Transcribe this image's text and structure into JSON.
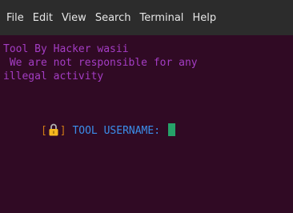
{
  "menubar": {
    "items": [
      "File",
      "Edit",
      "View",
      "Search",
      "Terminal",
      "Help"
    ]
  },
  "terminal": {
    "line1": "Tool By Hacker wasii",
    "line2": " We are not responsible for any",
    "line3": "illegal activity",
    "prompt": {
      "open_bracket": "[",
      "icon": "lock-icon",
      "close_bracket": "]",
      "label": " TOOL USERNAME: "
    }
  },
  "colors": {
    "menubar_bg": "#2c2c2c",
    "terminal_bg": "#300a24",
    "banner_text": "#a43dc4",
    "prompt_text": "#3b8eea",
    "bracket": "#d07b15",
    "cursor": "#26a269"
  }
}
